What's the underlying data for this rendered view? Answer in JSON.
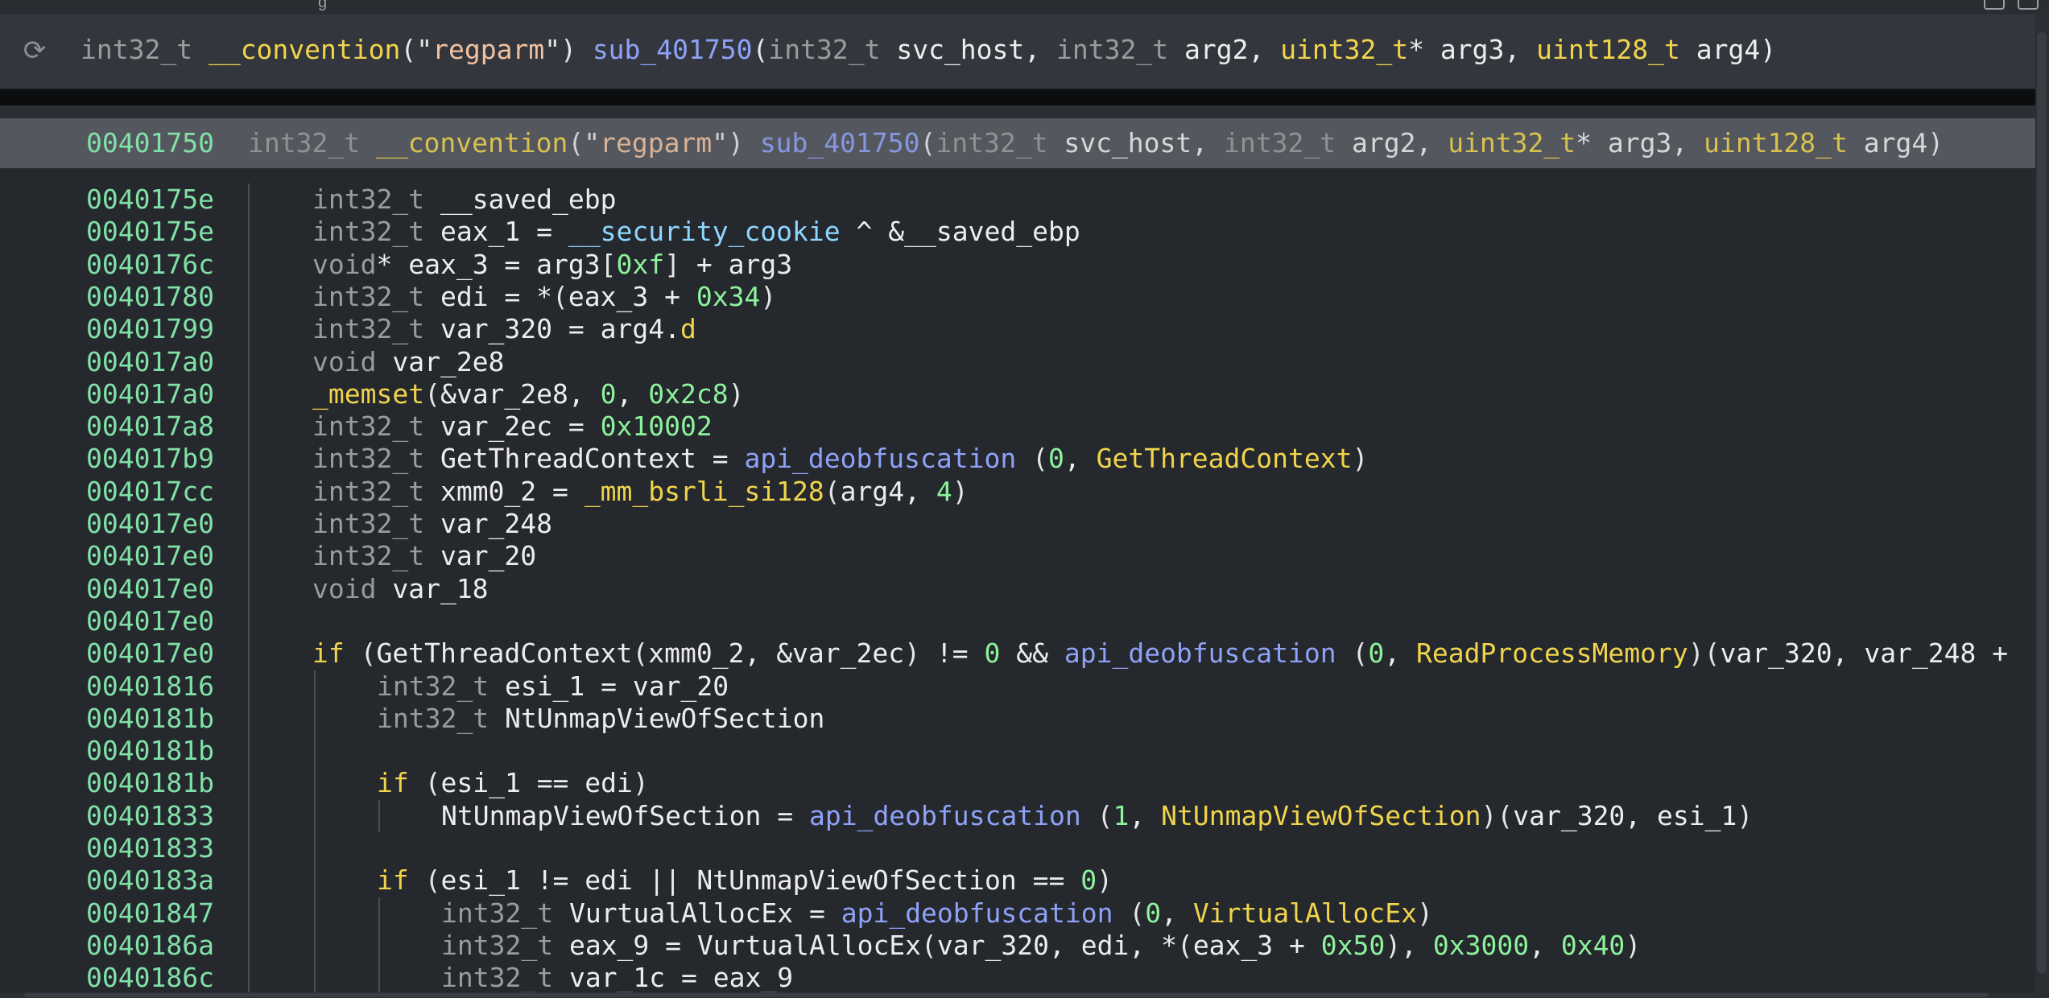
{
  "window": {
    "top_text": "g"
  },
  "header": {
    "signature": [
      {
        "t": "int32_t ",
        "c": "t"
      },
      {
        "t": "__convention",
        "c": "ext"
      },
      {
        "t": "(\"",
        "c": "op"
      },
      {
        "t": "regparm",
        "c": "str"
      },
      {
        "t": "\") ",
        "c": "op"
      },
      {
        "t": "sub_401750",
        "c": "fn"
      },
      {
        "t": "(",
        "c": "op"
      },
      {
        "t": "int32_t ",
        "c": "t"
      },
      {
        "t": "svc_host, ",
        "c": "kw"
      },
      {
        "t": "int32_t ",
        "c": "t"
      },
      {
        "t": "arg2, ",
        "c": "kw"
      },
      {
        "t": "uint32_t",
        "c": "ext"
      },
      {
        "t": "* arg3, ",
        "c": "kw"
      },
      {
        "t": "uint128_t ",
        "c": "ext"
      },
      {
        "t": "arg4)",
        "c": "kw"
      }
    ]
  },
  "function_line": {
    "address": "00401750",
    "signature": [
      {
        "t": "int32_t ",
        "c": "t"
      },
      {
        "t": "__convention",
        "c": "ext"
      },
      {
        "t": "(\"",
        "c": "op"
      },
      {
        "t": "regparm",
        "c": "str"
      },
      {
        "t": "\") ",
        "c": "op"
      },
      {
        "t": "sub_401750",
        "c": "fn"
      },
      {
        "t": "(",
        "c": "op"
      },
      {
        "t": "int32_t ",
        "c": "t"
      },
      {
        "t": "svc_host, ",
        "c": "kw"
      },
      {
        "t": "int32_t ",
        "c": "t"
      },
      {
        "t": "arg2, ",
        "c": "kw"
      },
      {
        "t": "uint32_t",
        "c": "ext"
      },
      {
        "t": "* arg3, ",
        "c": "kw"
      },
      {
        "t": "uint128_t ",
        "c": "ext"
      },
      {
        "t": "arg4)",
        "c": "kw"
      }
    ]
  },
  "code_lines": [
    {
      "addr": "0040175e",
      "indent": 0,
      "tokens": [
        {
          "t": "int32_t ",
          "c": "t"
        },
        {
          "t": "__saved_ebp",
          "c": "kw"
        }
      ]
    },
    {
      "addr": "0040175e",
      "indent": 0,
      "tokens": [
        {
          "t": "int32_t ",
          "c": "t"
        },
        {
          "t": "eax_1 = ",
          "c": "kw"
        },
        {
          "t": "__security_cookie",
          "c": "sym"
        },
        {
          "t": " ^ &__saved_ebp",
          "c": "kw"
        }
      ]
    },
    {
      "addr": "0040176c",
      "indent": 0,
      "tokens": [
        {
          "t": "void",
          "c": "t"
        },
        {
          "t": "* eax_3 = arg3",
          "c": "kw"
        },
        {
          "t": "[",
          "c": "op"
        },
        {
          "t": "0xf",
          "c": "num"
        },
        {
          "t": "]",
          "c": "op"
        },
        {
          "t": " + arg3",
          "c": "kw"
        }
      ]
    },
    {
      "addr": "00401780",
      "indent": 0,
      "tokens": [
        {
          "t": "int32_t ",
          "c": "t"
        },
        {
          "t": "edi = *",
          "c": "kw"
        },
        {
          "t": "(",
          "c": "op"
        },
        {
          "t": "eax_3 + ",
          "c": "kw"
        },
        {
          "t": "0x34",
          "c": "num"
        },
        {
          "t": ")",
          "c": "op"
        }
      ]
    },
    {
      "addr": "00401799",
      "indent": 0,
      "tokens": [
        {
          "t": "int32_t ",
          "c": "t"
        },
        {
          "t": "var_320 = arg4.",
          "c": "kw"
        },
        {
          "t": "d",
          "c": "fld"
        }
      ]
    },
    {
      "addr": "004017a0",
      "indent": 0,
      "tokens": [
        {
          "t": "void ",
          "c": "t"
        },
        {
          "t": "var_2e8",
          "c": "kw"
        }
      ]
    },
    {
      "addr": "004017a0",
      "indent": 0,
      "tokens": [
        {
          "t": "_memset",
          "c": "ext"
        },
        {
          "t": "(",
          "c": "op"
        },
        {
          "t": "&var_2e8, ",
          "c": "kw"
        },
        {
          "t": "0",
          "c": "num"
        },
        {
          "t": ", ",
          "c": "kw"
        },
        {
          "t": "0x2c8",
          "c": "num"
        },
        {
          "t": ")",
          "c": "op"
        }
      ]
    },
    {
      "addr": "004017a8",
      "indent": 0,
      "tokens": [
        {
          "t": "int32_t ",
          "c": "t"
        },
        {
          "t": "var_2ec = ",
          "c": "kw"
        },
        {
          "t": "0x10002",
          "c": "num"
        }
      ]
    },
    {
      "addr": "004017b9",
      "indent": 0,
      "tokens": [
        {
          "t": "int32_t ",
          "c": "t"
        },
        {
          "t": "GetThreadContext = ",
          "c": "kw"
        },
        {
          "t": "api_deobfuscation",
          "c": "fn"
        },
        {
          "t": " (",
          "c": "op"
        },
        {
          "t": "0",
          "c": "num"
        },
        {
          "t": ", ",
          "c": "kw"
        },
        {
          "t": "GetThreadContext",
          "c": "ext"
        },
        {
          "t": ")",
          "c": "op"
        }
      ]
    },
    {
      "addr": "004017cc",
      "indent": 0,
      "tokens": [
        {
          "t": "int32_t ",
          "c": "t"
        },
        {
          "t": "xmm0_2 = ",
          "c": "kw"
        },
        {
          "t": "_mm_bsrli_si128",
          "c": "ext"
        },
        {
          "t": "(",
          "c": "op"
        },
        {
          "t": "arg4, ",
          "c": "kw"
        },
        {
          "t": "4",
          "c": "num"
        },
        {
          "t": ")",
          "c": "op"
        }
      ]
    },
    {
      "addr": "004017e0",
      "indent": 0,
      "tokens": [
        {
          "t": "int32_t ",
          "c": "t"
        },
        {
          "t": "var_248",
          "c": "kw"
        }
      ]
    },
    {
      "addr": "004017e0",
      "indent": 0,
      "tokens": [
        {
          "t": "int32_t ",
          "c": "t"
        },
        {
          "t": "var_20",
          "c": "kw"
        }
      ]
    },
    {
      "addr": "004017e0",
      "indent": 0,
      "tokens": [
        {
          "t": "void ",
          "c": "t"
        },
        {
          "t": "var_18",
          "c": "kw"
        }
      ]
    },
    {
      "addr": "004017e0",
      "indent": 0,
      "tokens": []
    },
    {
      "addr": "004017e0",
      "indent": 0,
      "tokens": [
        {
          "t": "if ",
          "c": "ext"
        },
        {
          "t": "(",
          "c": "op"
        },
        {
          "t": "GetThreadContext",
          "c": "kw"
        },
        {
          "t": "(",
          "c": "op"
        },
        {
          "t": "xmm0_2, &var_2ec",
          "c": "kw"
        },
        {
          "t": ")",
          "c": "op"
        },
        {
          "t": " != ",
          "c": "kw"
        },
        {
          "t": "0",
          "c": "num"
        },
        {
          "t": " && ",
          "c": "kw"
        },
        {
          "t": "api_deobfuscation",
          "c": "fn"
        },
        {
          "t": " (",
          "c": "op"
        },
        {
          "t": "0",
          "c": "num"
        },
        {
          "t": ", ",
          "c": "kw"
        },
        {
          "t": "ReadProcessMemory",
          "c": "ext"
        },
        {
          "t": ")(",
          "c": "op"
        },
        {
          "t": "var_320, var_248 +",
          "c": "kw"
        }
      ]
    },
    {
      "addr": "00401816",
      "indent": 1,
      "tokens": [
        {
          "t": "int32_t ",
          "c": "t"
        },
        {
          "t": "esi_1 = var_20",
          "c": "kw"
        }
      ]
    },
    {
      "addr": "0040181b",
      "indent": 1,
      "tokens": [
        {
          "t": "int32_t ",
          "c": "t"
        },
        {
          "t": "NtUnmapViewOfSection",
          "c": "kw"
        }
      ]
    },
    {
      "addr": "0040181b",
      "indent": 1,
      "tokens": []
    },
    {
      "addr": "0040181b",
      "indent": 1,
      "tokens": [
        {
          "t": "if ",
          "c": "ext"
        },
        {
          "t": "(",
          "c": "op"
        },
        {
          "t": "esi_1 == edi",
          "c": "kw"
        },
        {
          "t": ")",
          "c": "op"
        }
      ]
    },
    {
      "addr": "00401833",
      "indent": 2,
      "tokens": [
        {
          "t": "NtUnmapViewOfSection = ",
          "c": "kw"
        },
        {
          "t": "api_deobfuscation",
          "c": "fn"
        },
        {
          "t": " (",
          "c": "op"
        },
        {
          "t": "1",
          "c": "num"
        },
        {
          "t": ", ",
          "c": "kw"
        },
        {
          "t": "NtUnmapViewOfSection",
          "c": "ext"
        },
        {
          "t": ")(",
          "c": "op"
        },
        {
          "t": "var_320, esi_1",
          "c": "kw"
        },
        {
          "t": ")",
          "c": "op"
        }
      ]
    },
    {
      "addr": "00401833",
      "indent": 1,
      "tokens": []
    },
    {
      "addr": "0040183a",
      "indent": 1,
      "tokens": [
        {
          "t": "if ",
          "c": "ext"
        },
        {
          "t": "(",
          "c": "op"
        },
        {
          "t": "esi_1 != edi || NtUnmapViewOfSection == ",
          "c": "kw"
        },
        {
          "t": "0",
          "c": "num"
        },
        {
          "t": ")",
          "c": "op"
        }
      ]
    },
    {
      "addr": "00401847",
      "indent": 2,
      "tokens": [
        {
          "t": "int32_t ",
          "c": "t"
        },
        {
          "t": "VurtualAllocEx = ",
          "c": "kw"
        },
        {
          "t": "api_deobfuscation",
          "c": "fn"
        },
        {
          "t": " (",
          "c": "op"
        },
        {
          "t": "0",
          "c": "num"
        },
        {
          "t": ", ",
          "c": "kw"
        },
        {
          "t": "VirtualAllocEx",
          "c": "ext"
        },
        {
          "t": ")",
          "c": "op"
        }
      ]
    },
    {
      "addr": "0040186a",
      "indent": 2,
      "tokens": [
        {
          "t": "int32_t ",
          "c": "t"
        },
        {
          "t": "eax_9 = VurtualAllocEx",
          "c": "kw"
        },
        {
          "t": "(",
          "c": "op"
        },
        {
          "t": "var_320, edi, *",
          "c": "kw"
        },
        {
          "t": "(",
          "c": "op"
        },
        {
          "t": "eax_3 + ",
          "c": "kw"
        },
        {
          "t": "0x50",
          "c": "num"
        },
        {
          "t": "), ",
          "c": "op"
        },
        {
          "t": "0x3000",
          "c": "num"
        },
        {
          "t": ", ",
          "c": "kw"
        },
        {
          "t": "0x40",
          "c": "num"
        },
        {
          "t": ")",
          "c": "op"
        }
      ]
    },
    {
      "addr": "0040186c",
      "indent": 2,
      "tokens": [
        {
          "t": "int32_t ",
          "c": "t"
        },
        {
          "t": "var_1c = eax_9",
          "c": "kw"
        }
      ]
    }
  ],
  "icons": {
    "refresh": "refresh-icon"
  }
}
